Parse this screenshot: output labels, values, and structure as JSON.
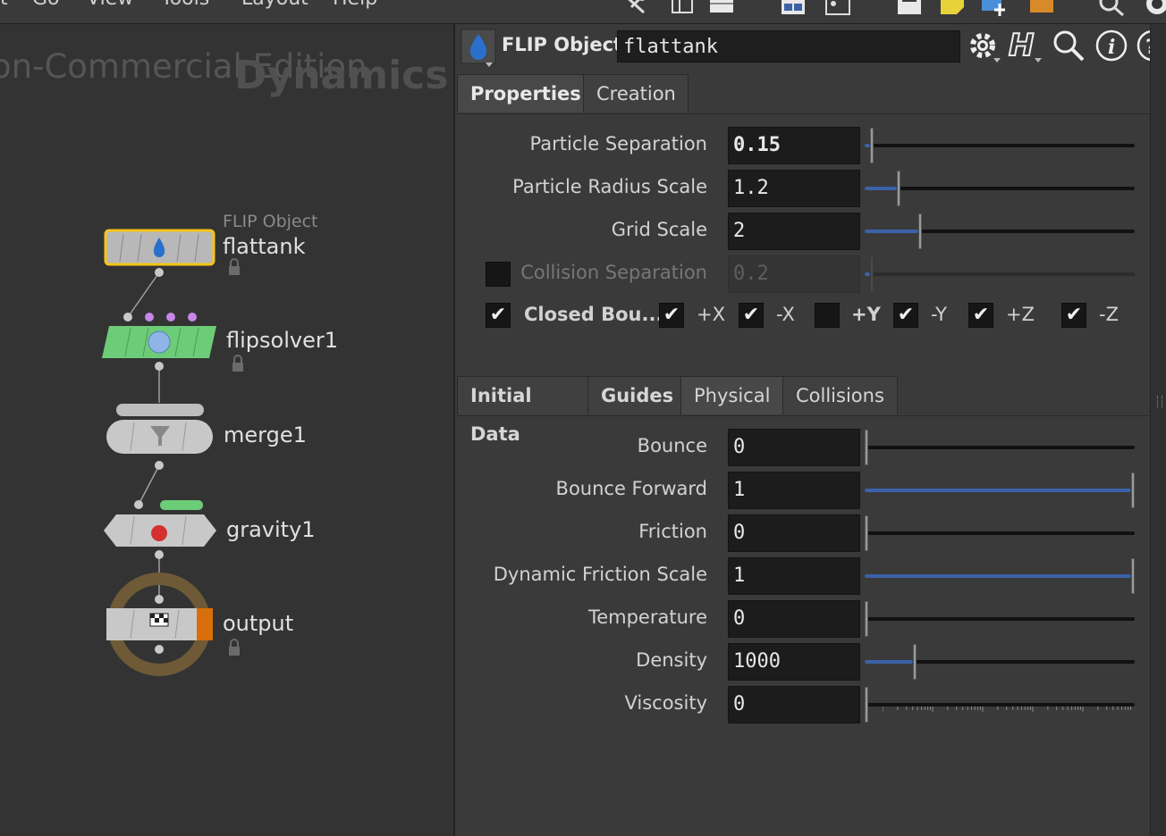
{
  "menu": {
    "items": [
      "t",
      "Go",
      "View",
      "Tools",
      "Layout",
      "Help"
    ]
  },
  "toolbar_icons": [
    "tools-icon",
    "layout-icon",
    "panel-icon",
    "grid-icon",
    "desktop-icon",
    "save-icon",
    "note-icon",
    "image-add-icon",
    "box-icon",
    "search-icon"
  ],
  "network": {
    "watermark_edition": "on-Commercial Edition",
    "watermark_context": "Dynamics",
    "nodes": [
      {
        "name": "flattank",
        "type_label": "FLIP Object",
        "color": "#9a9a9a",
        "locked": true,
        "selected": true
      },
      {
        "name": "flipsolver1",
        "color": "#6ccc78",
        "locked": true
      },
      {
        "name": "merge1",
        "color": "#c8c8c8"
      },
      {
        "name": "gravity1",
        "color": "#c8c8c8"
      },
      {
        "name": "output",
        "color": "#9a9a9a",
        "locked": true,
        "output_flag": "#d86f0a"
      }
    ]
  },
  "params": {
    "node_type": "FLIP Object",
    "node_name": "flattank",
    "top_tabs": [
      {
        "label": "Properties",
        "active": true
      },
      {
        "label": "Creation",
        "active": false
      }
    ],
    "top_rows": [
      {
        "label": "Particle Separation",
        "value": "0.15",
        "bold_value": true,
        "slider_fraction": 0.02
      },
      {
        "label": "Particle Radius Scale",
        "value": "1.2",
        "slider_fraction": 0.12
      },
      {
        "label": "Grid Scale",
        "value": "2",
        "slider_fraction": 0.2
      },
      {
        "label": "Collision Separation",
        "value": "0.2",
        "disabled": true,
        "slider_fraction": 0.02
      }
    ],
    "closed_boundaries": {
      "label": "Closed Bou...",
      "checked": true,
      "axes": [
        {
          "label": "+X",
          "checked": true
        },
        {
          "label": "-X",
          "checked": true
        },
        {
          "label": "+Y",
          "checked": false
        },
        {
          "label": "-Y",
          "checked": true
        },
        {
          "label": "+Z",
          "checked": true
        },
        {
          "label": "-Z",
          "checked": true
        }
      ]
    },
    "bottom_tabs": [
      {
        "label": "Initial Data",
        "active": false,
        "bold": true
      },
      {
        "label": "Guides",
        "active": false,
        "bold": true
      },
      {
        "label": "Physical",
        "active": true,
        "bold": false
      },
      {
        "label": "Collisions",
        "active": false,
        "bold": false
      }
    ],
    "physical_rows": [
      {
        "label": "Bounce",
        "value": "0",
        "slider_fraction": 0.0
      },
      {
        "label": "Bounce Forward",
        "value": "1",
        "slider_fraction": 1.0
      },
      {
        "label": "Friction",
        "value": "0",
        "slider_fraction": 0.0
      },
      {
        "label": "Dynamic Friction Scale",
        "value": "1",
        "slider_fraction": 1.0
      },
      {
        "label": "Temperature",
        "value": "0",
        "slider_fraction": 0.0
      },
      {
        "label": "Density",
        "value": "1000",
        "slider_fraction": 0.18
      },
      {
        "label": "Viscosity",
        "value": "0",
        "slider_fraction": 0.0,
        "log_ticks": true
      }
    ]
  },
  "colors": {
    "accent_blue": "#3b62a8",
    "selected_outline": "#f5c518",
    "solver_green": "#6ccc78",
    "output_ring": "#6e5a36"
  }
}
